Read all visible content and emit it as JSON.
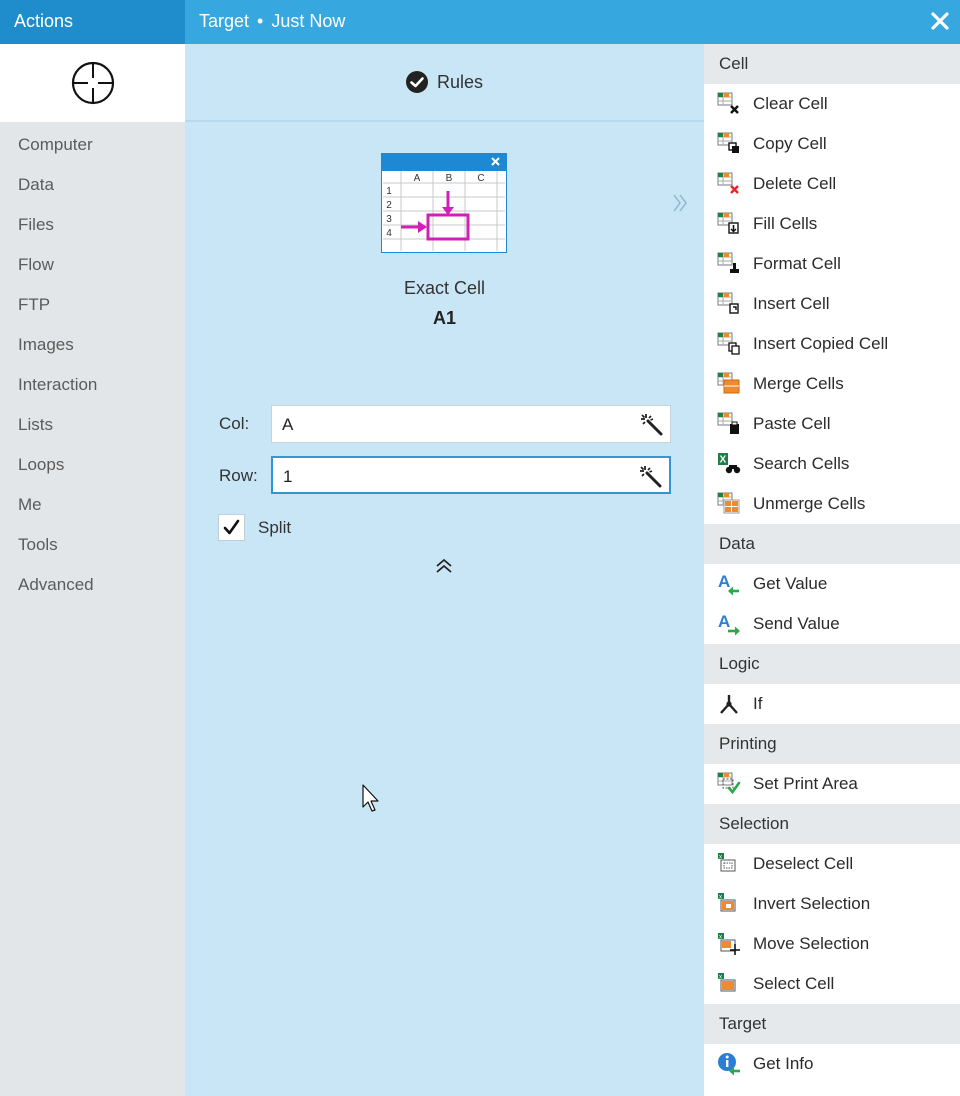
{
  "left": {
    "header": "Actions",
    "categories": [
      "Computer",
      "Data",
      "Files",
      "Flow",
      "FTP",
      "Images",
      "Interaction",
      "Lists",
      "Loops",
      "Me",
      "Tools",
      "Advanced"
    ]
  },
  "topbar": {
    "target": "Target",
    "separator": "•",
    "time": "Just Now"
  },
  "center": {
    "rules_label": "Rules",
    "illustration": {
      "columns": [
        "A",
        "B",
        "C"
      ],
      "rows": [
        "1",
        "2",
        "3",
        "4"
      ]
    },
    "action_name": "Exact Cell",
    "action_value": "A1",
    "col_label": "Col:",
    "col_value": "A",
    "row_label": "Row:",
    "row_value": "1",
    "split_label": "Split",
    "split_checked": true
  },
  "right": {
    "sections": [
      {
        "title": "Cell",
        "items": [
          {
            "label": "Clear Cell",
            "icon": "clear-cell-icon"
          },
          {
            "label": "Copy Cell",
            "icon": "copy-cell-icon"
          },
          {
            "label": "Delete Cell",
            "icon": "delete-cell-icon"
          },
          {
            "label": "Fill Cells",
            "icon": "fill-cells-icon"
          },
          {
            "label": "Format Cell",
            "icon": "format-cell-icon"
          },
          {
            "label": "Insert Cell",
            "icon": "insert-cell-icon"
          },
          {
            "label": "Insert Copied Cell",
            "icon": "insert-copied-cell-icon"
          },
          {
            "label": "Merge Cells",
            "icon": "merge-cells-icon"
          },
          {
            "label": "Paste Cell",
            "icon": "paste-cell-icon"
          },
          {
            "label": "Search Cells",
            "icon": "search-cells-icon"
          },
          {
            "label": "Unmerge Cells",
            "icon": "unmerge-cells-icon"
          }
        ]
      },
      {
        "title": "Data",
        "items": [
          {
            "label": "Get Value",
            "icon": "get-value-icon"
          },
          {
            "label": "Send Value",
            "icon": "send-value-icon"
          }
        ]
      },
      {
        "title": "Logic",
        "items": [
          {
            "label": "If",
            "icon": "if-branch-icon"
          }
        ]
      },
      {
        "title": "Printing",
        "items": [
          {
            "label": "Set Print Area",
            "icon": "set-print-area-icon"
          }
        ]
      },
      {
        "title": "Selection",
        "items": [
          {
            "label": "Deselect Cell",
            "icon": "deselect-cell-icon"
          },
          {
            "label": "Invert Selection",
            "icon": "invert-selection-icon"
          },
          {
            "label": "Move Selection",
            "icon": "move-selection-icon"
          },
          {
            "label": "Select Cell",
            "icon": "select-cell-icon"
          }
        ]
      },
      {
        "title": "Target",
        "items": [
          {
            "label": "Get Info",
            "icon": "get-info-icon"
          }
        ]
      }
    ]
  },
  "colors": {
    "actions_header": "#1f8dcb",
    "topbar": "#36a7df",
    "center_bg": "#c9e6f6",
    "sidebar_bg": "#e2e6e8",
    "highlight_magenta": "#d21fb8",
    "excel_green": "#1e7e45"
  }
}
